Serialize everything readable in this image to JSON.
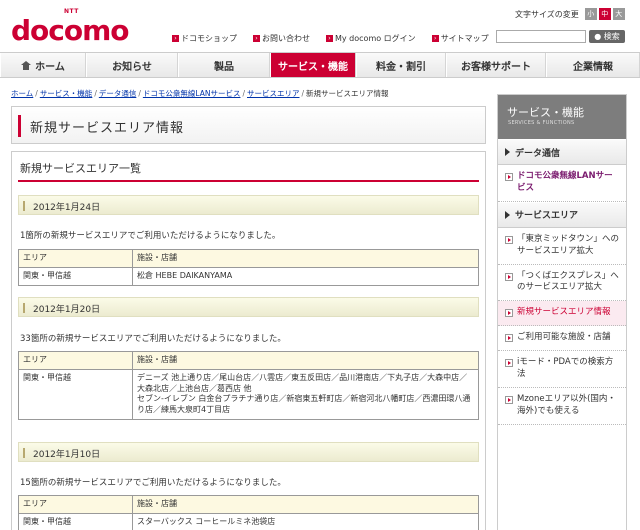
{
  "header": {
    "logo_ntt": "NTT",
    "logo_text": "docomo",
    "links": [
      {
        "label": "ドコモショップ"
      },
      {
        "label": "お問い合わせ"
      },
      {
        "label": "My docomo ログイン"
      },
      {
        "label": "サイトマップ"
      }
    ],
    "font_size_label": "文字サイズの変更",
    "font_sizes": [
      "小",
      "中",
      "大"
    ],
    "search_placeholder": "",
    "search_button": "検索"
  },
  "nav": {
    "items": [
      {
        "label": "ホーム"
      },
      {
        "label": "お知らせ"
      },
      {
        "label": "製品"
      },
      {
        "label": "サービス・機能",
        "active": true
      },
      {
        "label": "料金・割引"
      },
      {
        "label": "お客様サポート"
      },
      {
        "label": "企業情報"
      }
    ]
  },
  "breadcrumb": {
    "links": [
      "ホーム",
      "サービス・機能",
      "データ通信",
      "ドコモ公衆無線LANサービス",
      "サービスエリア"
    ],
    "current": "新規サービスエリア情報"
  },
  "page_title": "新規サービスエリア情報",
  "main": {
    "section_title": "新規サービスエリア一覧",
    "col_area": "エリア",
    "col_store": "施設・店舗",
    "entries": [
      {
        "date": "2012年1月24日",
        "desc": "1箇所の新規サービスエリアでご利用いただけるようになりました。",
        "area": "関東・甲信越",
        "stores": "松倉 HEBE DAIKANYAMA"
      },
      {
        "date": "2012年1月20日",
        "desc": "33箇所の新規サービスエリアでご利用いただけるようになりました。",
        "area": "関東・甲信越",
        "stores_line1": "デニーズ 池上通り店／尾山台店／八雲店／東五反田店／品川港南店／下丸子店／大森中店／大森北店／上池台店／葛西店 他",
        "stores_line2": "セブン-イレブン 白金台プラチナ通り店／新宿東五軒町店／新宿河北八幡町店／西濃田環八通り店／練馬大泉町4丁目店"
      },
      {
        "date": "2012年1月10日",
        "desc": "15箇所の新規サービスエリアでご利用いただけるようになりました。",
        "area": "関東・甲信越",
        "stores": "スターバックス コーヒールミネ池袋店"
      }
    ]
  },
  "sidebar": {
    "title": "サービス・機能",
    "subtitle": "SERVICES & FUNCTIONS",
    "cat1": "データ通信",
    "link_lan": "ドコモ公衆無線LANサービス",
    "cat2": "サービスエリア",
    "links": [
      {
        "label": "「東京ミッドタウン」へのサービスエリア拡大"
      },
      {
        "label": "「つくばエクスプレス」へのサービスエリア拡大"
      },
      {
        "label": "新規サービスエリア情報"
      },
      {
        "label": "ご利用可能な施設・店舗"
      },
      {
        "label": "iモード・PDAでの検索方法"
      },
      {
        "label": "Mzoneエリア以外(国内・海外)でも使える"
      }
    ]
  }
}
